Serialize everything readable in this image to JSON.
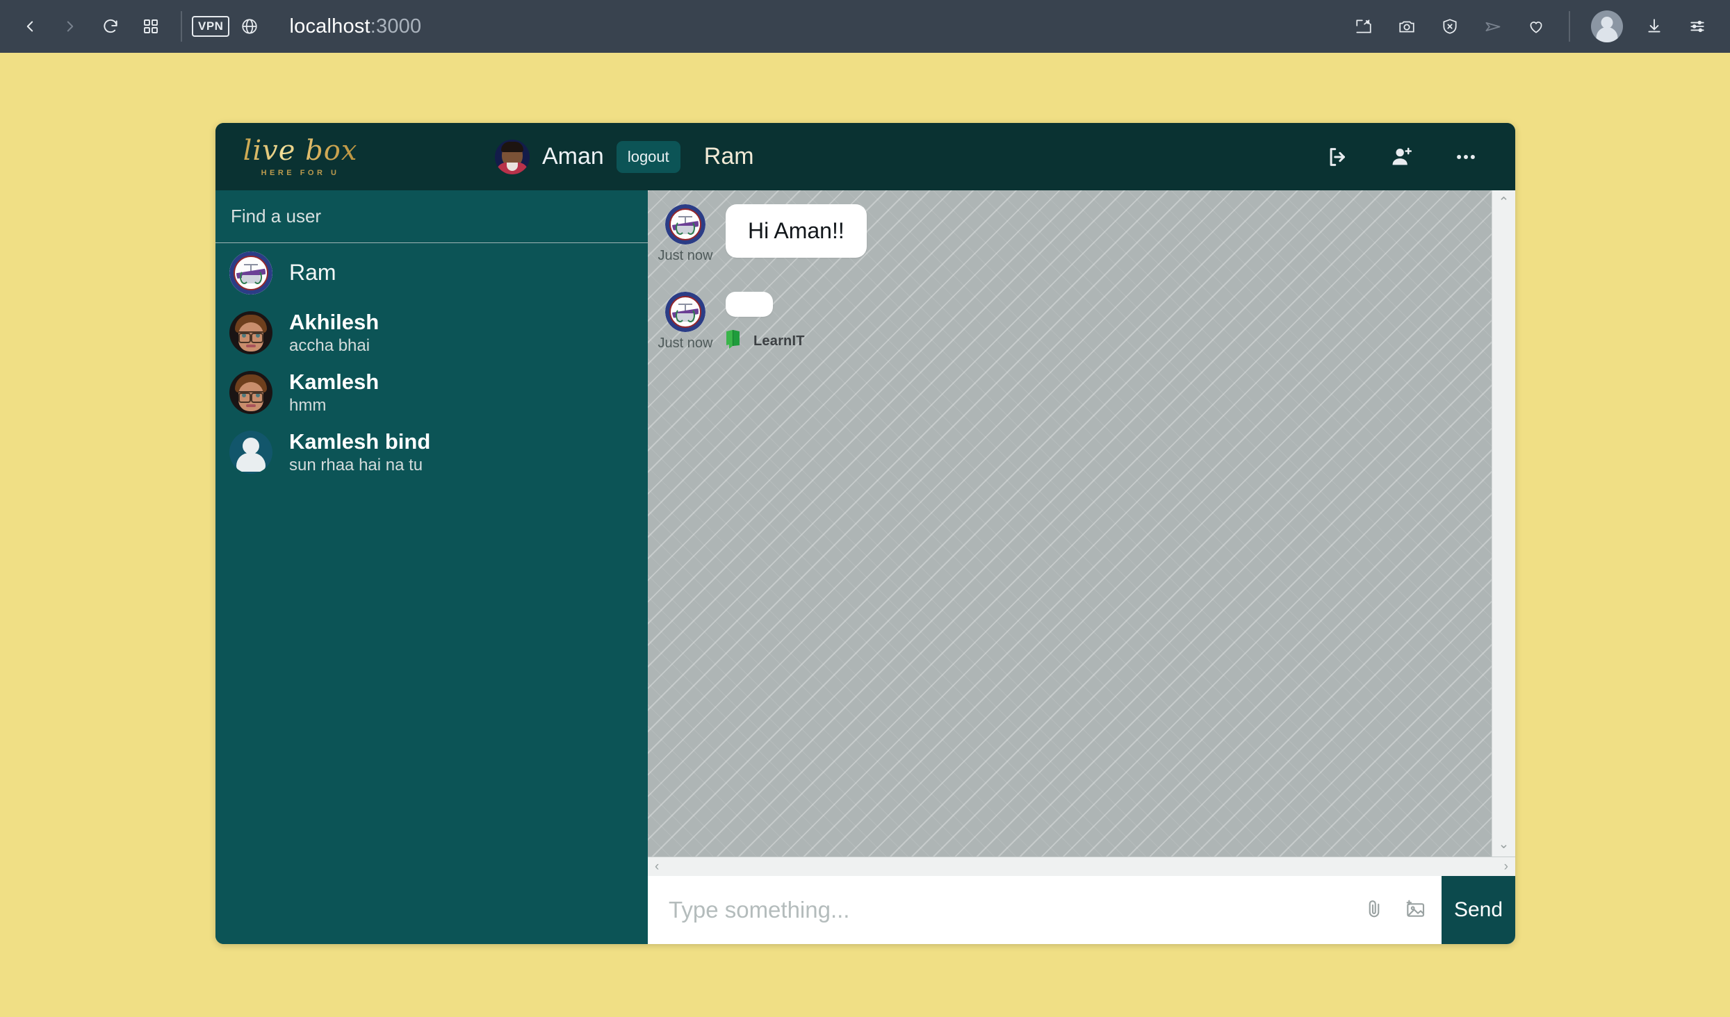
{
  "browser": {
    "url_host": "localhost",
    "url_port": ":3000",
    "vpn_label": "VPN",
    "icons": {
      "back": "back-chevron-icon",
      "forward": "forward-chevron-icon",
      "reload": "reload-icon",
      "grid": "grid-tabs-icon",
      "globe": "globe-icon",
      "pin": "pin-to-screen-icon",
      "camera": "camera-icon",
      "shield": "shield-block-icon",
      "send": "telegram-send-icon",
      "heart": "heart-icon",
      "profile": "profile-avatar-icon",
      "download": "download-icon",
      "settings": "settings-sliders-icon"
    }
  },
  "app": {
    "logo": {
      "name": "live box",
      "tagline": "HERE FOR U"
    },
    "current_user": {
      "name": "Aman"
    },
    "logout_label": "logout",
    "peer_title": "Ram",
    "header_icons": {
      "exit": "exit-logout-icon",
      "add_user": "add-user-icon",
      "more": "more-options-icon"
    }
  },
  "sidebar": {
    "search_label": "Find a user",
    "users": [
      {
        "name": "Ram",
        "preview": "",
        "avatar": "seal"
      },
      {
        "name": "Akhilesh",
        "preview": "accha bhai",
        "avatar": "toon"
      },
      {
        "name": "Kamlesh",
        "preview": "hmm",
        "avatar": "toon"
      },
      {
        "name": "Kamlesh bind",
        "preview": "sun rhaa hai na tu",
        "avatar": "person"
      }
    ]
  },
  "chat": {
    "messages": [
      {
        "text": "Hi Aman!!",
        "time": "Just now",
        "avatar": "seal",
        "attachment": null
      },
      {
        "text": "",
        "time": "Just now",
        "avatar": "seal",
        "attachment": {
          "label": "LearnIT",
          "icon": "learnit-book-icon"
        }
      }
    ],
    "scroll": {
      "up_arrow": "⌃",
      "down_arrow": "⌄",
      "left_arrow": "‹",
      "right_arrow": "›"
    }
  },
  "composer": {
    "placeholder": "Type something...",
    "value": "",
    "send_label": "Send",
    "icons": {
      "attach": "paperclip-icon",
      "image": "add-image-icon"
    }
  },
  "colors": {
    "page_bg": "#f0df85",
    "header": "#0a3232",
    "sidebar": "#0c5456",
    "chat_bg": "#aeb5b5",
    "accent_gold": "#c8a24a",
    "send_btn": "#0c4a4d"
  }
}
